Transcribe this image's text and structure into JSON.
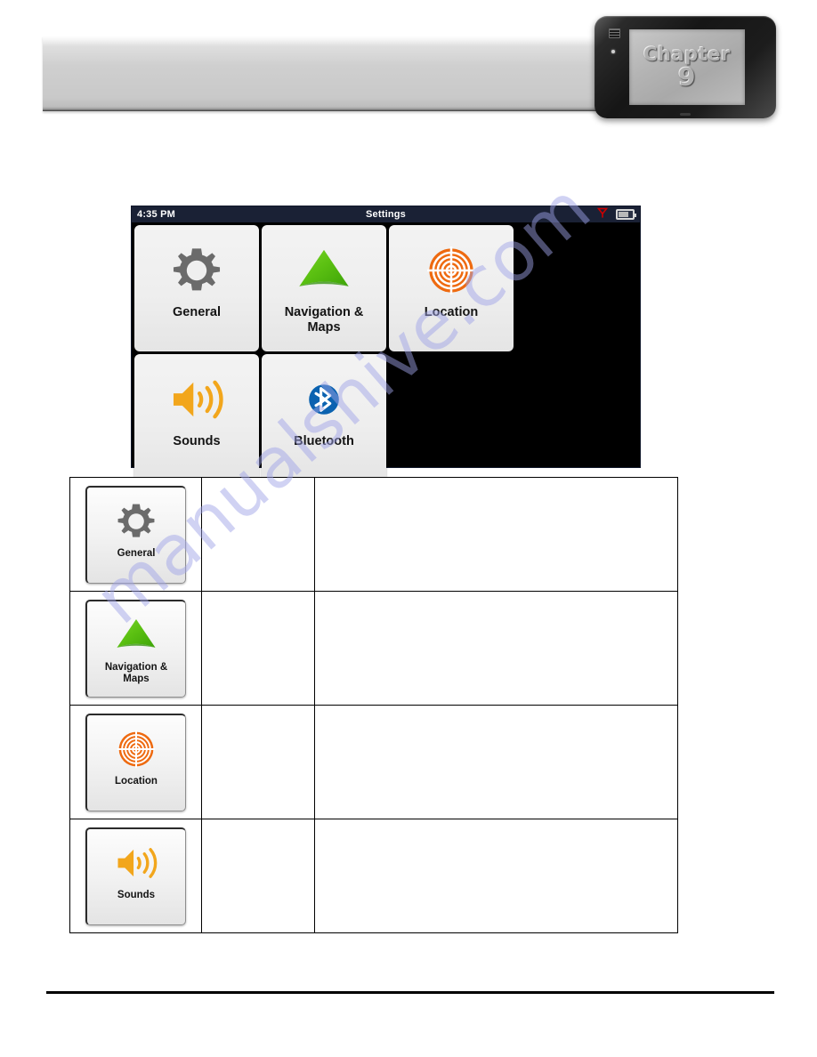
{
  "page": {
    "watermark": "manualshive.com"
  },
  "chapter_device": {
    "label": "Chapter",
    "number": "9",
    "icons": {
      "speaker": "speaker-grille-icon",
      "camera": "front-camera-icon",
      "home": "home-button-icon"
    }
  },
  "settings_screen": {
    "status_bar": {
      "time": "4:35 PM",
      "title": "Settings",
      "signal_icon": "antenna-signal-icon",
      "signal_color": "#cc0000",
      "battery_icon": "battery-icon",
      "battery_level_percent": 55,
      "background": "#1a2135"
    },
    "tiles": [
      {
        "label": "General",
        "icon": "gear-icon",
        "color": "#666666"
      },
      {
        "label": "Navigation &\nMaps",
        "icon": "nav-arrow-icon",
        "color": "#55c400"
      },
      {
        "label": "Location",
        "icon": "target-icon",
        "color": "#ed6a10"
      },
      {
        "label": "Sounds",
        "icon": "speaker-icon",
        "color": "#f0a31a"
      },
      {
        "label": "Bluetooth",
        "icon": "bluetooth-icon",
        "color": "#0a62b0"
      }
    ]
  },
  "legend_table": {
    "rows": [
      {
        "button_label": "General",
        "icon": "gear-icon",
        "middle": "",
        "description": ""
      },
      {
        "button_label": "Navigation &\nMaps",
        "icon": "nav-arrow-icon",
        "middle": "",
        "description": ""
      },
      {
        "button_label": "Location",
        "icon": "target-icon",
        "middle": "",
        "description": ""
      },
      {
        "button_label": "Sounds",
        "icon": "speaker-icon",
        "middle": "",
        "description": ""
      }
    ]
  }
}
